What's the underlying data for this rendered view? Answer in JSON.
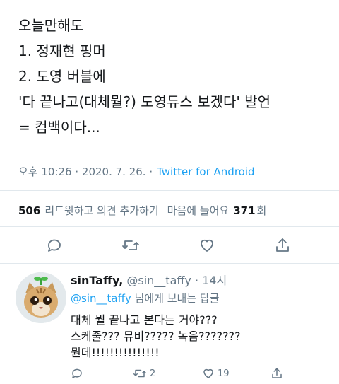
{
  "tweet": {
    "lines": [
      "오늘만해도",
      "1. 정재현 핑머",
      "2. 도영 버블에",
      "'다 끝나고(대체뭘?) 도영듀스 보겠다' 발언",
      "= 컴백이다..."
    ],
    "timestamp": "오후 10:26 · 2020. 7. 26. ·",
    "source": "Twitter for Android",
    "retweets_count": "506",
    "retweets_label": "리트윗하고 의견 추가하기",
    "likes_label_pre": "마음에 들어요",
    "likes_count": "371",
    "likes_label_post": "회"
  },
  "actions": [
    "reply-icon",
    "retweet-icon",
    "like-icon",
    "share-icon"
  ],
  "reply": {
    "name": "sinTaffy,",
    "handle_time": "@sin__taffy · 14시",
    "to_handle": "@sin__taffy",
    "to_suffix": " 님에게 보내는 답글",
    "lines": [
      "대체 뭘 끝나고 본다는 거야???",
      "스케줄??? 뮤비????? 녹음???????",
      "뭔데!!!!!!!!!!!!!!!"
    ],
    "retweet_count": "2",
    "like_count": "19"
  },
  "colors": {
    "link": "#1da1f2",
    "muted": "#657786",
    "text": "#14171a",
    "divider": "#e1e8ed"
  }
}
